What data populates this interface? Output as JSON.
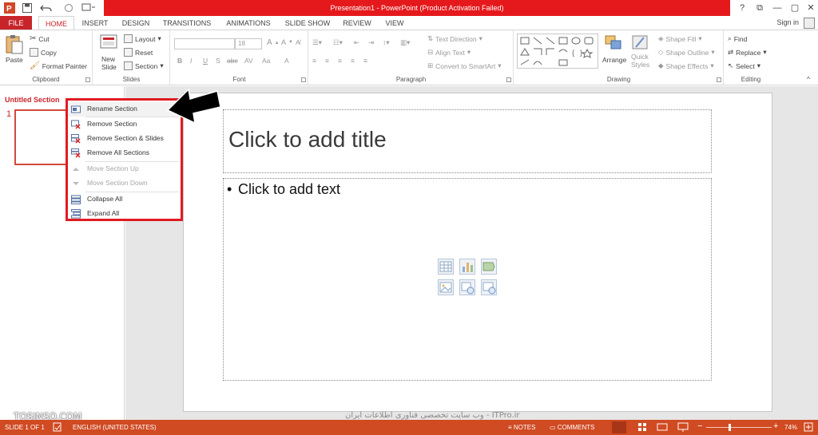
{
  "app": {
    "title": "Presentation1 - PowerPoint (Product Activation Failed)",
    "sign_in": "Sign in"
  },
  "qat": {
    "app_icon": "powerpoint-logo-icon",
    "save_icon": "save-icon",
    "undo_icon": "undo-icon",
    "redo_icon": "redo-icon",
    "start_icon": "start-from-beginning-icon"
  },
  "window": {
    "help": "?",
    "restore_ribbon": "⧉",
    "minimize": "—",
    "maximize": "▢",
    "close": "✕"
  },
  "tabs": [
    "FILE",
    "HOME",
    "INSERT",
    "DESIGN",
    "TRANSITIONS",
    "ANIMATIONS",
    "SLIDE SHOW",
    "REVIEW",
    "VIEW"
  ],
  "ribbon": {
    "clipboard": {
      "label": "Clipboard",
      "paste": "Paste",
      "cut": "Cut",
      "copy": "Copy",
      "format_painter": "Format Painter"
    },
    "slides": {
      "label": "Slides",
      "new_slide": "New Slide",
      "layout": "Layout",
      "reset": "Reset",
      "section": "Section"
    },
    "font": {
      "label": "Font",
      "font_size": "18",
      "bold": "B",
      "italic": "I",
      "underline": "U",
      "shadow": "S",
      "strike": "abc",
      "spacing": "AV",
      "case": "Aa",
      "color": "A"
    },
    "paragraph": {
      "label": "Paragraph",
      "text_direction": "Text Direction",
      "align_text": "Align Text",
      "convert_smartart": "Convert to SmartArt"
    },
    "drawing": {
      "label": "Drawing",
      "arrange": "Arrange",
      "quick_styles": "Quick Styles",
      "shape_fill": "Shape Fill",
      "shape_outline": "Shape Outline",
      "shape_effects": "Shape Effects"
    },
    "editing": {
      "label": "Editing",
      "find": "Find",
      "replace": "Replace",
      "select": "Select"
    }
  },
  "left_pane": {
    "section_title": "Untitled Section",
    "slide_number": "1"
  },
  "slide": {
    "title_placeholder": "Click to add title",
    "content_placeholder": "Click to add text",
    "bullet": "•"
  },
  "context_menu": [
    {
      "label": "Rename Section",
      "icon": "rename-section-icon",
      "enabled": true
    },
    {
      "label": "Remove Section",
      "icon": "remove-section-icon",
      "enabled": true
    },
    {
      "label": "Remove Section & Slides",
      "icon": "remove-section-slides-icon",
      "enabled": true
    },
    {
      "label": "Remove All Sections",
      "icon": "remove-all-sections-icon",
      "enabled": true
    },
    {
      "label": "Move Section Up",
      "icon": "move-up-icon",
      "enabled": false
    },
    {
      "label": "Move Section Down",
      "icon": "move-down-icon",
      "enabled": false
    },
    {
      "label": "Collapse All",
      "icon": "collapse-all-icon",
      "enabled": true
    },
    {
      "label": "Expand All",
      "icon": "expand-all-icon",
      "enabled": true
    }
  ],
  "watermark": "وب سایت تخصصی فناوری اطلاعات ایران - ITPro.ir",
  "overlay_brand": "TOSINSO.COM",
  "status": {
    "slide_info": "SLIDE 1 OF 1",
    "language": "ENGLISH (UNITED STATES)",
    "notes": "NOTES",
    "comments": "COMMENTS",
    "zoom": "74%",
    "zoom_level_percent": 74,
    "minus": "−",
    "plus": "+",
    "accent": "#d04a22"
  },
  "colors": {
    "title_bar": "#e5191c",
    "file_tab": "#c8252b",
    "status_bar": "#d04a22",
    "menu_highlight": "#e01b22"
  }
}
